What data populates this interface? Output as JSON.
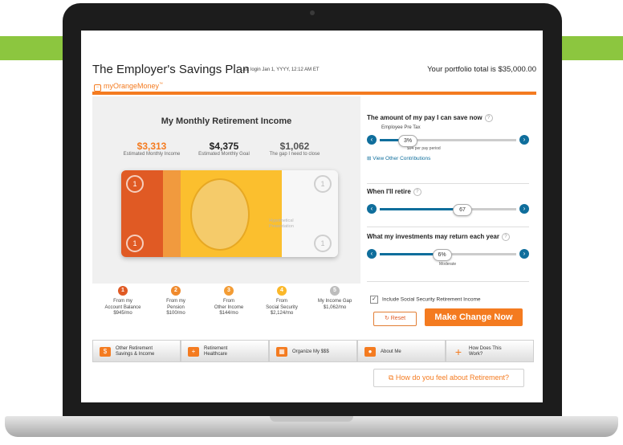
{
  "header": {
    "title": "The Employer's Savings Plan",
    "last_login": "Last login Jan 1, YYYY, 12:12 AM ET",
    "portfolio_total": "Your portfolio total is $35,000.00",
    "brand": "myOrangeMoney",
    "brand_tm": "™"
  },
  "income": {
    "title": "My Monthly Retirement Income",
    "stats": [
      {
        "value": "$3,313",
        "label": "Estimated Monthly Income",
        "color": "#f47b20"
      },
      {
        "value": "$4,375",
        "label": "Estimated Monthly Goal",
        "color": "#222222"
      },
      {
        "value": "$1,062",
        "label": "The gap I need to close",
        "color": "#555555"
      }
    ],
    "bill_note_line1": "Hypothetical",
    "bill_note_line2": "Presentation",
    "sources": [
      {
        "num": "1",
        "line1": "From my",
        "line2": "Account Balance",
        "amount": "$945/mo",
        "color": "#e05a24"
      },
      {
        "num": "2",
        "line1": "From my",
        "line2": "Pension",
        "amount": "$100/mo",
        "color": "#f08a2c"
      },
      {
        "num": "3",
        "line1": "From",
        "line2": "Other Income",
        "amount": "$144/mo",
        "color": "#f39c34"
      },
      {
        "num": "4",
        "line1": "From",
        "line2": "Social Security",
        "amount": "$2,124/mo",
        "color": "#fbb829"
      },
      {
        "num": "5",
        "line1": "My Income Gap",
        "line2": "",
        "amount": "$1,062/mo",
        "color": "#bdbdbd"
      }
    ]
  },
  "controls": {
    "save": {
      "title": "The amount of my pay I can save now",
      "sub_label": "Employee Pre Tax",
      "value": "3%",
      "level": 0.2,
      "note": "$94 per pay period",
      "link": "View Other Contributions"
    },
    "retire": {
      "title": "When I'll retire",
      "value": "67",
      "level": 0.6
    },
    "returns": {
      "title": "What my investments may return each year",
      "value": "6%",
      "level": 0.45,
      "note": "Moderate"
    },
    "include_ss": "Include Social Security Retirement Income",
    "reset": "Reset",
    "make_change": "Make Change Now"
  },
  "nav": {
    "items": [
      {
        "line1": "Other Retirement",
        "line2": "Savings & Income"
      },
      {
        "line1": "Retirement",
        "line2": "Healthcare"
      },
      {
        "line1": "Organize My $$$",
        "line2": ""
      },
      {
        "line1": "About Me",
        "line2": ""
      },
      {
        "line1": "How Does This",
        "line2": "Work?"
      }
    ],
    "feel": "How do you feel about Retirement?"
  },
  "icons": {
    "help": "question-icon",
    "left": "chevron-left-icon",
    "right": "chevron-right-icon",
    "external": "external-link-icon"
  },
  "colors": {
    "accent": "#f47b20",
    "brand_green": "#8cc63f",
    "slider_blue": "#0f6e9c"
  }
}
